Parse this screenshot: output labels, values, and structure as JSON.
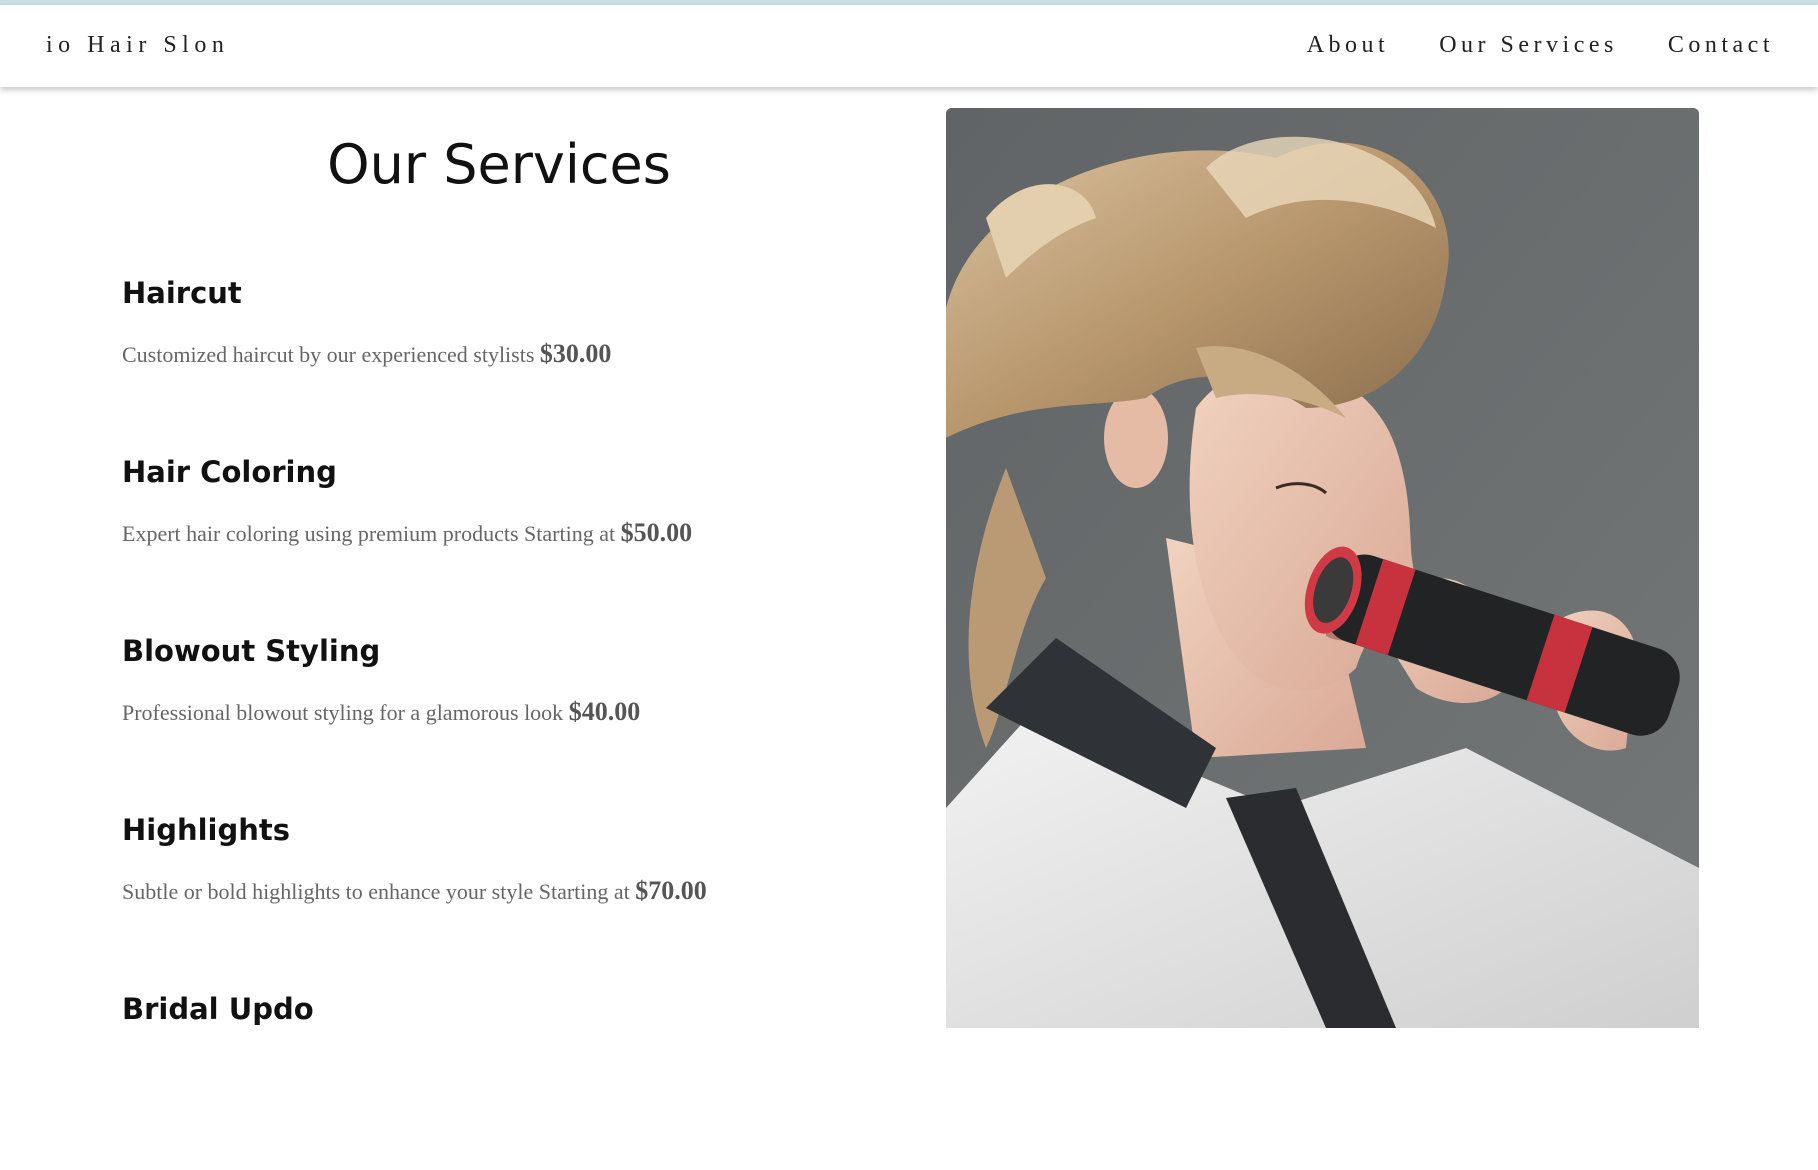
{
  "header": {
    "brand": "io Hair Slon",
    "nav": [
      {
        "label": "About"
      },
      {
        "label": "Our Services"
      },
      {
        "label": "Contact"
      }
    ]
  },
  "services": {
    "title": "Our Services",
    "items": [
      {
        "name": "Haircut",
        "description": "Customized haircut by our experienced stylists",
        "price": "$30.00"
      },
      {
        "name": "Hair Coloring",
        "description": "Expert hair coloring using premium products Starting at",
        "price": "$50.00"
      },
      {
        "name": "Blowout Styling",
        "description": "Professional blowout styling for a glamorous look",
        "price": "$40.00"
      },
      {
        "name": "Highlights",
        "description": "Subtle or bold highlights to enhance your style Starting at",
        "price": "$70.00"
      },
      {
        "name": "Bridal Updo",
        "description": "",
        "price": ""
      }
    ]
  },
  "colors": {
    "accent_strip": "#c9dfe2",
    "photo_background": "#6b6e70",
    "price_text": "#555555",
    "description_text": "#666666"
  }
}
